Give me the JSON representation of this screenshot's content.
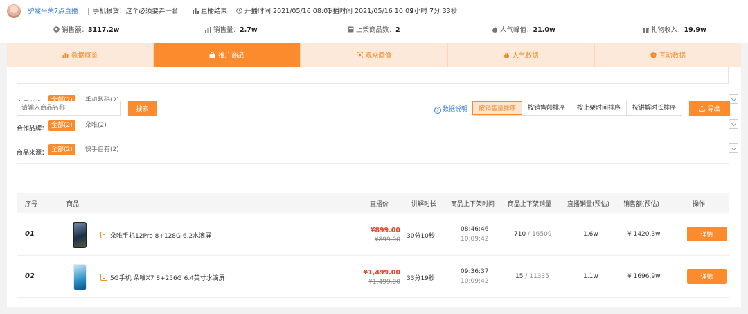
{
  "header": {
    "anchor_name": "驴嫂平荣7点直播",
    "separator": "|",
    "live_title": "手机狠货！这个必须要弄一台",
    "live_status": "直播结束",
    "start_time": "开播时间 2021/05/16 08:01",
    "end_time": "下播时间 2021/05/16 10:09",
    "duration": "2小时 7分 33秒"
  },
  "stats": [
    {
      "label": "销售额：",
      "value": "3117.2w",
      "icon": "coin-icon"
    },
    {
      "label": "销售量：",
      "value": "2.7w",
      "icon": "bar-chart-icon"
    },
    {
      "label": "上架商品数：",
      "value": "2",
      "icon": "box-icon"
    },
    {
      "label": "人气峰值：",
      "value": "21.0w",
      "icon": "flame-icon"
    },
    {
      "label": "礼物收入：",
      "value": "19.9w",
      "icon": "gift-icon"
    }
  ],
  "tabs": [
    {
      "label": "数据概览",
      "icon": "chart-icon"
    },
    {
      "label": "推广商品",
      "icon": "bag-icon",
      "active": true
    },
    {
      "label": "观众画像",
      "icon": "face-icon"
    },
    {
      "label": "人气数据",
      "icon": "flame-icon"
    },
    {
      "label": "互动数据",
      "icon": "chat-icon"
    }
  ],
  "filters": [
    {
      "label": "商品分类：",
      "selected": "全部(2)",
      "option": "手机数码(2)"
    },
    {
      "label": "合作品牌：",
      "selected": "全部(2)",
      "option": "朵唯(2)"
    },
    {
      "label": "商品来源：",
      "selected": "全部(2)",
      "option": "快手自有(2)"
    }
  ],
  "toolbar": {
    "search_placeholder": "请输入商品名称",
    "search_button": "搜索",
    "data_desc": "数据说明",
    "sort_options": [
      "按销售量排序",
      "按销售额排序",
      "按上架时间排序",
      "按讲解时长排序"
    ],
    "active_sort": "按销售量排序",
    "export_button": "导出"
  },
  "table": {
    "headers": [
      "序号",
      "商品",
      "直播价",
      "讲解时长",
      "商品上下架时间",
      "商品上下架销量",
      "直播销量(预估)",
      "销售额(预估)",
      "操作"
    ],
    "rows": [
      {
        "index": "01",
        "name": "朵唯手机12Pro 8+128G 6.2水滴屏",
        "price": "¥899.00",
        "original_price": "¥899.00",
        "explain_duration": "30分10秒",
        "on_time": "08:46:46",
        "off_time": "10:09:42",
        "sales_on": "710",
        "sales_slash": " / ",
        "sales_off": "16509",
        "live_sales": "1.6w",
        "revenue": "¥ 1420.3w",
        "action": "详情"
      },
      {
        "index": "02",
        "name": "5G手机 朵唯X7 8+256G 6.4英寸水滴屏",
        "price": "¥1,499.00",
        "original_price": "¥1,499.00",
        "explain_duration": "33分19秒",
        "on_time": "09:36:37",
        "off_time": "10:09:42",
        "sales_on": "15",
        "sales_slash": " / ",
        "sales_off": "11335",
        "live_sales": "1.1w",
        "revenue": "¥ 1696.9w",
        "action": "详情"
      }
    ]
  },
  "colors": {
    "accent": "#fb8b2d",
    "tab_bg": "#fde9d9",
    "link": "#2e7bd6",
    "price": "#e8452b"
  }
}
